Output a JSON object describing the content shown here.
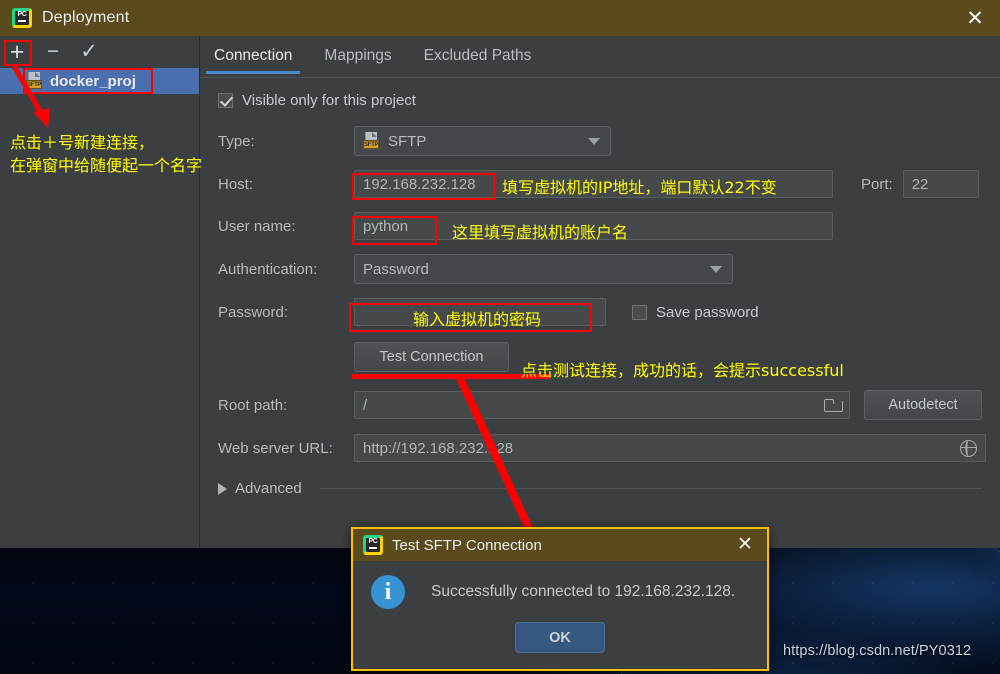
{
  "window": {
    "title": "Deployment",
    "logo_icon": "pycharm-logo-icon",
    "close_icon": "close-icon"
  },
  "left_pane": {
    "toolbar": [
      {
        "name": "add",
        "glyph": "+"
      },
      {
        "name": "remove",
        "glyph": "−"
      },
      {
        "name": "set-default",
        "glyph": "✓"
      }
    ],
    "tree": [
      {
        "label": "docker_proj",
        "icon": "sftp-server-icon",
        "selected": true
      }
    ]
  },
  "tabs": [
    {
      "label": "Connection",
      "active": true
    },
    {
      "label": "Mappings",
      "active": false
    },
    {
      "label": "Excluded Paths",
      "active": false
    }
  ],
  "form": {
    "visible_only_checkbox": {
      "label": "Visible only for this project",
      "checked": true
    },
    "type": {
      "label": "Type:",
      "value": "SFTP",
      "icon": "sftp-icon"
    },
    "host": {
      "label": "Host:",
      "value": "192.168.232.128"
    },
    "port": {
      "label": "Port:",
      "value": "22"
    },
    "username": {
      "label": "User name:",
      "value": "python"
    },
    "authentication": {
      "label": "Authentication:",
      "value": "Password"
    },
    "password": {
      "label": "Password:",
      "value": ""
    },
    "save_password": {
      "label": "Save password",
      "checked": false
    },
    "test_connection_button": "Test Connection",
    "root_path": {
      "label": "Root path:",
      "value": "/",
      "browse_icon": "folder-icon"
    },
    "autodetect_button": "Autodetect",
    "web_server_url": {
      "label": "Web server URL:",
      "value": "http://192.168.232.128",
      "open_icon": "globe-icon"
    },
    "advanced": {
      "label": "Advanced",
      "expanded": false,
      "icon": "chevron-right-icon"
    }
  },
  "annotations": [
    {
      "id": "note-add-connection",
      "text_line1": "点击＋号新建连接，",
      "text_line2": "在弹窗中给随便起一个名字"
    },
    {
      "id": "note-host",
      "text": "填写虚拟机的IP地址，端口默认22不变"
    },
    {
      "id": "note-username",
      "text": "这里填写虚拟机的账户名"
    },
    {
      "id": "note-password",
      "text": "输入虚拟机的密码"
    },
    {
      "id": "note-test",
      "text": "点击测试连接，成功的话，会提示successful"
    }
  ],
  "dialog": {
    "title": "Test SFTP Connection",
    "logo_icon": "pycharm-logo-icon",
    "close_icon": "close-icon",
    "info_icon": "info-icon",
    "message": "Successfully connected to 192.168.232.128.",
    "ok_button": "OK"
  },
  "desktop": {
    "watermark": "https://blog.csdn.net/PY0312"
  },
  "colors": {
    "title_bar": "#5b4a1c",
    "panel_bg": "#3c3f41",
    "accent_tab": "#4a88c7",
    "selection": "#4b6eaf",
    "annotation": "#ffff00",
    "annotation_box": "#ff0000",
    "dialog_border": "#ffbf00",
    "info_icon": "#3592d4",
    "ok_button": "#365880"
  }
}
